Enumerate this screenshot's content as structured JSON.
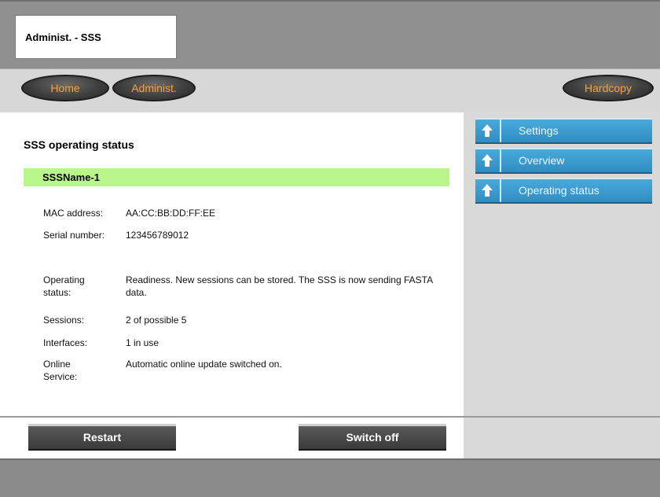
{
  "window": {
    "title": "Administ. - SSS"
  },
  "nav": {
    "home": "Home",
    "administ": "Administ.",
    "hardcopy": "Hardcopy"
  },
  "page": {
    "title": "SSS operating status",
    "device_name": "SSSName-1"
  },
  "fields": {
    "mac_label": "MAC address:",
    "mac_value": "AA:CC:BB:DD:FF:EE",
    "serial_label": "Serial number:",
    "serial_value": "123456789012",
    "opstatus_label": "Operating status:",
    "opstatus_value": "Readiness. New sessions can be stored. The SSS is now sending FASTA data.",
    "sessions_label": "Sessions:",
    "sessions_value": "2 of possible 5",
    "interfaces_label": "Interfaces:",
    "interfaces_value": "1 in use",
    "online_label": "Online Service:",
    "online_value": "Automatic online update switched on."
  },
  "sidebar": {
    "items": [
      {
        "label": "Settings",
        "icon": "up-arrow-icon"
      },
      {
        "label": "Overview",
        "icon": "up-arrow-icon"
      },
      {
        "label": "Operating status",
        "icon": "up-arrow-icon"
      }
    ]
  },
  "actions": {
    "restart": "Restart",
    "switch_off": "Switch off"
  },
  "colors": {
    "name_bar": "#b9f68c",
    "nav_text": "#f2a23c",
    "sidebar_button": "#3a9bd0"
  }
}
